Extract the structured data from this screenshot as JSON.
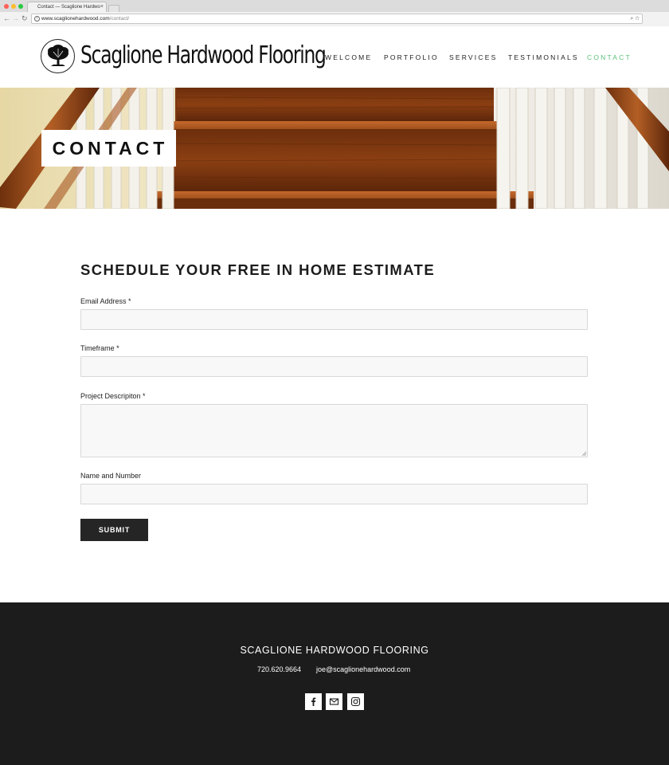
{
  "browser": {
    "tab_title": "Contact — Scaglione Hardwo",
    "tab_close": "×",
    "url_domain": "www.scaglionehardwood.com",
    "url_path": "/contact/",
    "info_glyph": "i",
    "zoom_glyph": "⌕",
    "star_glyph": "☆",
    "back_glyph": "←",
    "forward_glyph": "→",
    "reload_glyph": "↻"
  },
  "header": {
    "logo_text": "Scaglione Hardwood Flooring",
    "nav": [
      {
        "label": "WELCOME",
        "active": false
      },
      {
        "label": "PORTFOLIO",
        "active": false
      },
      {
        "label": "SERVICES",
        "active": false
      },
      {
        "label": "TESTIMONIALS",
        "active": false
      },
      {
        "label": "CONTACT",
        "active": true
      }
    ],
    "active_color": "#5bc07a"
  },
  "hero": {
    "title": "CONTACT"
  },
  "form": {
    "title": "SCHEDULE YOUR FREE IN HOME ESTIMATE",
    "fields": [
      {
        "label": "Email Address *",
        "value": ""
      },
      {
        "label": "Timeframe *",
        "value": ""
      },
      {
        "label": "Project Descripiton *",
        "value": ""
      },
      {
        "label": "Name and Number",
        "value": ""
      }
    ],
    "submit_label": "SUBMIT"
  },
  "footer": {
    "title": "SCAGLIONE HARDWOOD FLOORING",
    "phone": "720.620.9664",
    "email": "joe@scaglionehardwood.com",
    "social_icons": [
      "facebook-icon",
      "email-icon",
      "instagram-icon"
    ]
  }
}
